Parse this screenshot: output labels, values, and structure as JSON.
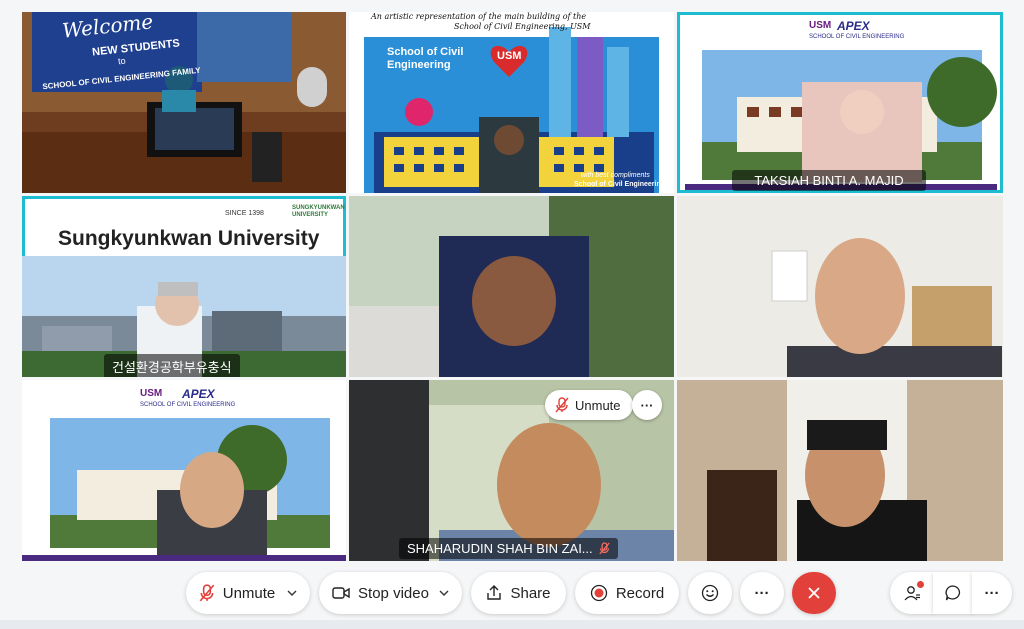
{
  "tiles": {
    "t1": {
      "banner_line1": "Welcome",
      "banner_line2": "NEW STUDENTS",
      "banner_line3": "to",
      "banner_line4": "SCHOOL OF CIVIL ENGINEERING FAMILY"
    },
    "t2": {
      "caption_line1": "An artistic representation of the main building of the",
      "caption_line2": "School of Civil Engineering, USM",
      "school_label": "School of Civil Engineering",
      "badge": "USM",
      "compliments_1": "with best compliments",
      "compliments_2": "School of Civil Engineering"
    },
    "t3": {
      "logo1": "USM",
      "logo2": "APEX",
      "logo_sub": "SCHOOL OF CIVIL ENGINEERING",
      "name": "TAKSIAH BINTI A. MAJID"
    },
    "t4": {
      "title": "Sungkyunkwan University",
      "since": "SINCE 1398",
      "logo_text": "SUNGKYUNKWAN UNIVERSITY",
      "name": "건설환경공학부유충식"
    },
    "t7": {
      "logo1": "USM",
      "logo2": "APEX",
      "logo_sub": "SCHOOL OF CIVIL ENGINEERING"
    },
    "t8": {
      "unmute_label": "Unmute",
      "more_label": "···",
      "name": "SHAHARUDIN SHAH BIN ZAI..."
    }
  },
  "toolbar": {
    "unmute_label": "Unmute",
    "stop_video_label": "Stop video",
    "share_label": "Share",
    "record_label": "Record",
    "more_label": "···",
    "side_more_label": "···"
  },
  "colors": {
    "active_border": "#1ebcd0",
    "end_call": "#e1413a",
    "record_dot": "#e1413a",
    "badge_dot": "#e1413a"
  }
}
